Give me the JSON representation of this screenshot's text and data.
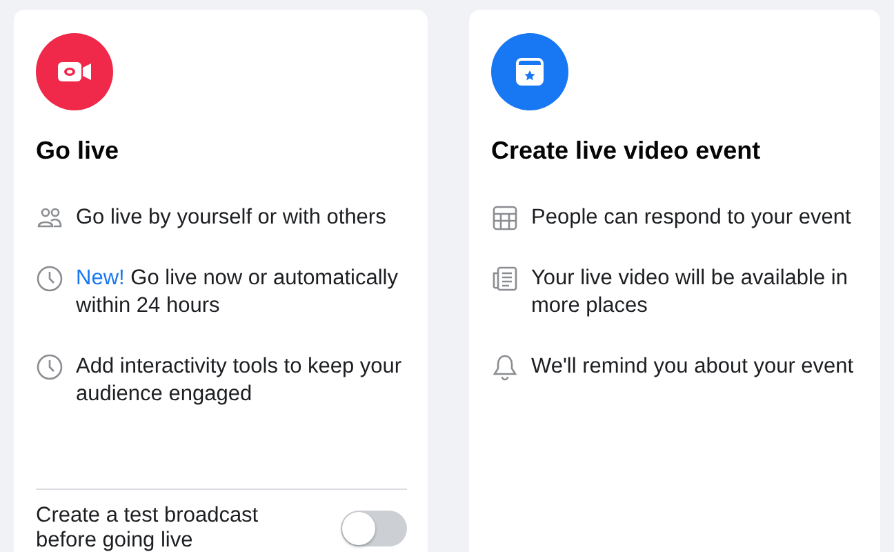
{
  "cards": [
    {
      "title": "Go live",
      "features": [
        {
          "text": "Go live by yourself or with others"
        },
        {
          "badge": "New!",
          "text": "Go live now or automatically within 24 hours"
        },
        {
          "text": "Add interactivity tools to keep your audience engaged"
        }
      ],
      "toggle": {
        "label": "Create a test broadcast before going live",
        "on": false
      }
    },
    {
      "title": "Create live video event",
      "features": [
        {
          "text": "People can respond to your event"
        },
        {
          "text": "Your live video will be available in more places"
        },
        {
          "text": "We'll remind you about your event"
        }
      ]
    }
  ]
}
